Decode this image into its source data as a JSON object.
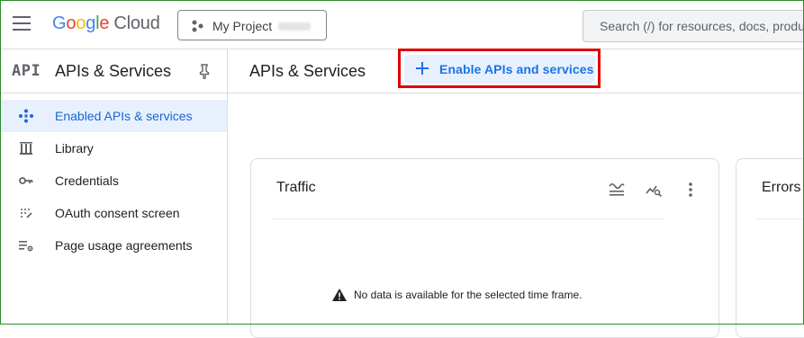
{
  "topbar": {
    "logo_parts": [
      "G",
      "o",
      "o",
      "g",
      "l",
      "e"
    ],
    "logo_suffix": "Cloud",
    "project_label": "My Project",
    "search_placeholder": "Search (/) for resources, docs, products"
  },
  "sidebar": {
    "api_logo": "API",
    "title": "APIs & Services",
    "items": [
      {
        "label": "Enabled APIs & services",
        "icon": "diamond-dots-icon",
        "active": true
      },
      {
        "label": "Library",
        "icon": "library-icon",
        "active": false
      },
      {
        "label": "Credentials",
        "icon": "key-icon",
        "active": false
      },
      {
        "label": "OAuth consent screen",
        "icon": "consent-grid-icon",
        "active": false
      },
      {
        "label": "Page usage agreements",
        "icon": "settings-list-icon",
        "active": false
      }
    ]
  },
  "main": {
    "title": "APIs & Services",
    "enable_button_label": "Enable APIs and services",
    "cards": [
      {
        "title": "Traffic",
        "empty_message": "No data is available for the selected time frame."
      },
      {
        "title": "Errors"
      }
    ]
  },
  "colors": {
    "accent": "#1a73e8",
    "active_bg": "#e8f0fe",
    "highlight": "#e00000"
  }
}
